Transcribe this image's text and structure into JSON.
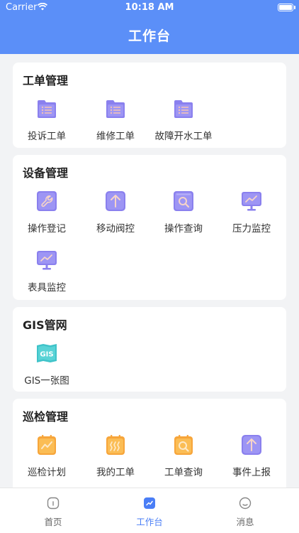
{
  "status_bar": {
    "carrier": "Carrier",
    "time": "10:18 AM"
  },
  "header": {
    "title": "工作台"
  },
  "sections": [
    {
      "title": "工单管理",
      "items": [
        {
          "label": "投诉工单",
          "icon": "folder-list-icon"
        },
        {
          "label": "维修工单",
          "icon": "folder-list-icon"
        },
        {
          "label": "故障开水工单",
          "icon": "folder-list-icon"
        }
      ]
    },
    {
      "title": "设备管理",
      "items": [
        {
          "label": "操作登记",
          "icon": "wrench-icon"
        },
        {
          "label": "移动阀控",
          "icon": "arrow-up-icon"
        },
        {
          "label": "操作查询",
          "icon": "search-screen-icon"
        },
        {
          "label": "压力监控",
          "icon": "monitor-chart-icon"
        },
        {
          "label": "表具监控",
          "icon": "monitor-chart-icon"
        }
      ]
    },
    {
      "title": "GIS管网",
      "items": [
        {
          "label": "GIS一张图",
          "icon": "gis-map-icon"
        }
      ]
    },
    {
      "title": "巡检管理",
      "items": [
        {
          "label": "巡检计划",
          "icon": "calendar-chart-icon"
        },
        {
          "label": "我的工单",
          "icon": "calendar-waves-icon"
        },
        {
          "label": "工单查询",
          "icon": "calendar-search-icon"
        },
        {
          "label": "事件上报",
          "icon": "arrow-up-icon"
        }
      ]
    }
  ],
  "tabbar": {
    "home": "首页",
    "workbench": "工作台",
    "messages": "消息",
    "active": "workbench"
  },
  "colors": {
    "header": "#5b8ff8",
    "purple_icon": "#8a80ee",
    "orange_icon": "#f7a53a",
    "gis_icon": "#3fc3c9",
    "active_tab": "#4a7ef6"
  }
}
